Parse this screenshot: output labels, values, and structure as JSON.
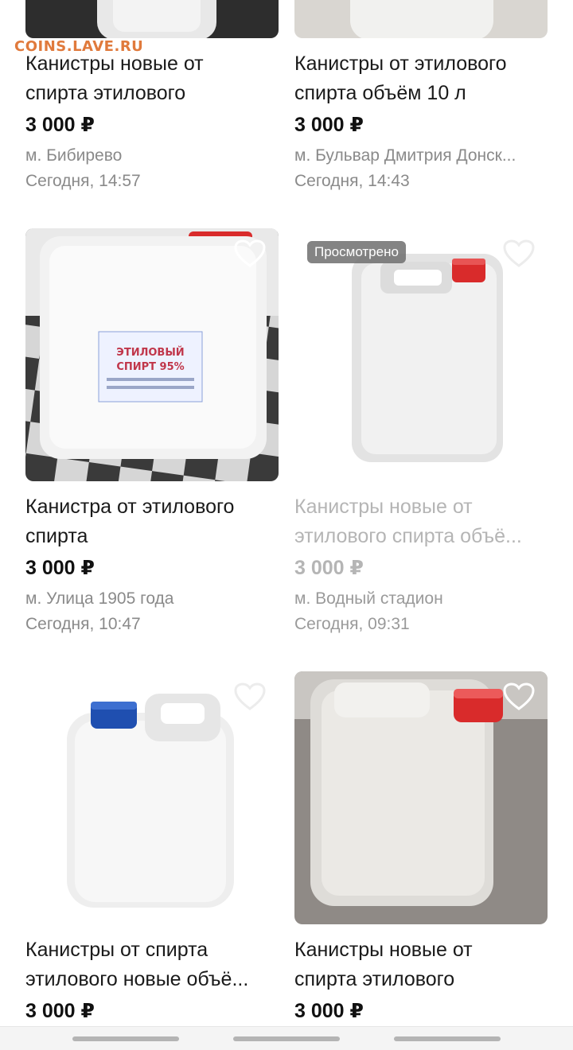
{
  "watermark": "COINS.LAVE.RU",
  "listings": [
    {
      "title_line1": "Канистры новые от",
      "title_line2": "спирта этилового",
      "price": "3 000 ₽",
      "metro": "м. Бибирево",
      "date": "Сегодня, 14:57",
      "viewed": false
    },
    {
      "title_line1": "Канистры от этилового",
      "title_line2": "спирта объём 10 л",
      "price": "3 000 ₽",
      "metro": "м. Бульвар Дмитрия Донск...",
      "date": "Сегодня, 14:43",
      "viewed": false
    },
    {
      "title_line1": "Канистра от этилового",
      "title_line2": "спирта",
      "price": "3 000 ₽",
      "metro": "м. Улица 1905 года",
      "date": "Сегодня, 10:47",
      "viewed": false,
      "label_line1": "ЭТИЛОВЫЙ",
      "label_line2": "СПИРТ 95%"
    },
    {
      "title_line1": "Канистры новые от",
      "title_line2": "этилового спирта объё...",
      "price": "3 000 ₽",
      "metro": "м. Водный стадион",
      "date": "Сегодня, 09:31",
      "viewed": true,
      "viewed_label": "Просмотрено"
    },
    {
      "title_line1": "Канистры от спирта",
      "title_line2": "этилового новые объё...",
      "price": "3 000 ₽",
      "viewed": false
    },
    {
      "title_line1": "Канистры новые от",
      "title_line2": "спирта этилового",
      "price": "3 000 ₽",
      "viewed": false
    }
  ],
  "icons": {
    "favorite": "heart-outline-icon",
    "images": "canister-photo"
  },
  "colors": {
    "text": "#1a1a1a",
    "muted": "#8a8a8a",
    "viewed_text": "#b5b5b5",
    "watermark": "#e07a3c",
    "cap_red": "#d92b2b",
    "cap_blue": "#1f4fb0"
  }
}
